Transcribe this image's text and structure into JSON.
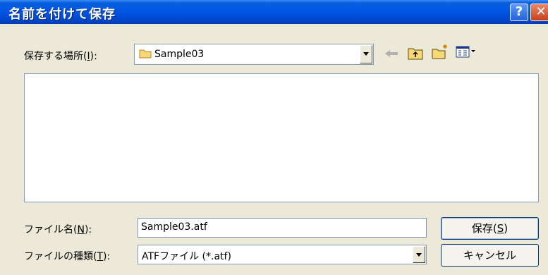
{
  "window": {
    "title": "名前を付けて保存",
    "help_symbol": "?",
    "close_symbol": "✕"
  },
  "save_in": {
    "label_prefix": "保存する場所(",
    "label_accel": "I",
    "label_suffix": "):",
    "folder": "Sample03"
  },
  "toolbar_icons": [
    "back-arrow-icon",
    "up-folder-icon",
    "new-folder-icon",
    "view-menu-icon"
  ],
  "file_name": {
    "label_prefix": "ファイル名(",
    "label_accel": "N",
    "label_suffix": "):",
    "value": "Sample03.atf"
  },
  "file_type": {
    "label_prefix": "ファイルの種類(",
    "label_accel": "T",
    "label_suffix": "):",
    "value": "ATFファイル (*.atf)"
  },
  "buttons": {
    "save_prefix": "保存(",
    "save_accel": "S",
    "save_suffix": ")",
    "cancel": "キャンセル"
  },
  "colors": {
    "titlebar": "#0054e3",
    "dialog_bg": "#ece9d8",
    "field_border": "#7f9db9"
  }
}
